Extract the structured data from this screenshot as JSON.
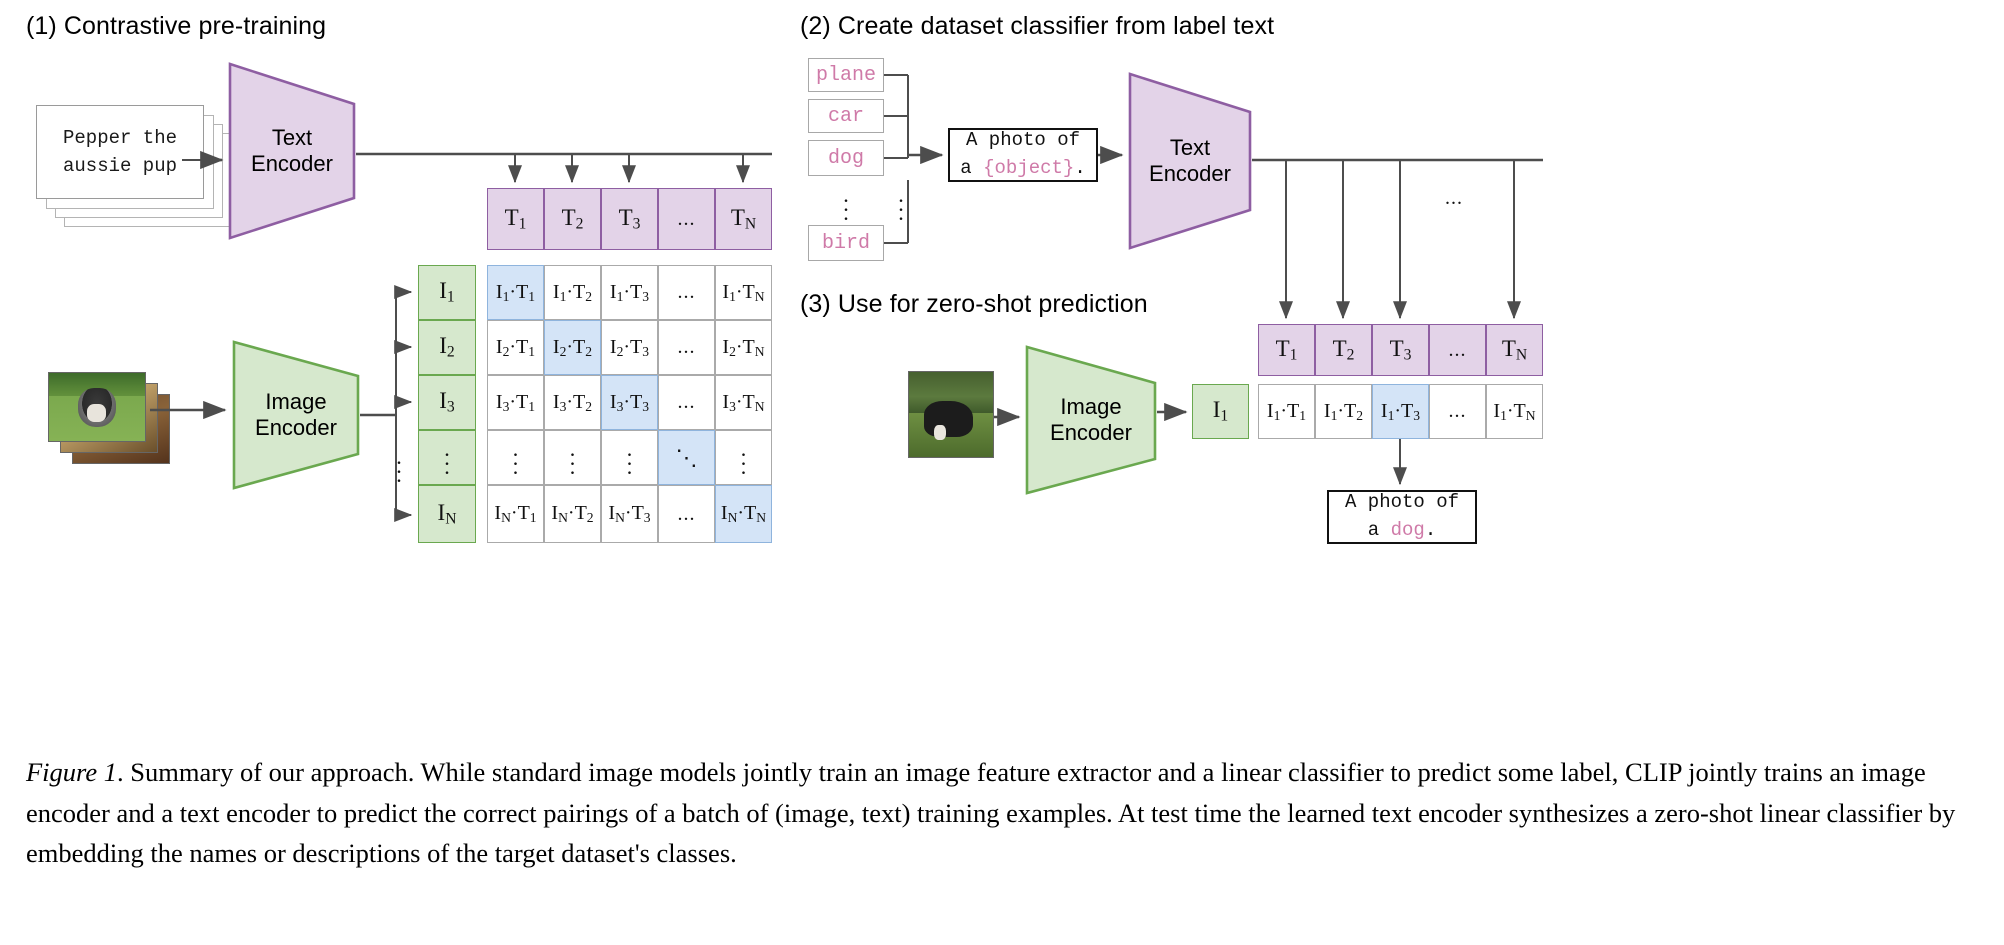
{
  "figure": {
    "caption_label": "Figure 1",
    "caption_text": ". Summary of our approach. While standard image models jointly train an image feature extractor and a linear classifier to predict some label, CLIP jointly trains an image encoder and a text encoder to predict the correct pairings of a batch of (image, text) training examples. At test time the learned text encoder synthesizes a zero-shot linear classifier by embedding the names or descriptions of the target dataset's classes."
  },
  "colors": {
    "text_encoder_fill": "#e3d3e8",
    "text_encoder_stroke": "#8e5ea2",
    "image_encoder_fill": "#d6e8cd",
    "image_encoder_stroke": "#6aa84f",
    "highlight_cell_fill": "#d4e4f7",
    "highlight_cell_stroke": "#8fb4dd",
    "label_pink": "#cf7aa8",
    "grid_stroke": "#aaaaaa",
    "arrow_stroke": "#4d4d4d"
  },
  "panel1": {
    "title": "(1) Contrastive pre-training",
    "input_caption": "Pepper the\naussie pup",
    "text_encoder_label": "Text\nEncoder",
    "image_encoder_label": "Image\nEncoder",
    "text_tokens": [
      "T₁",
      "T₂",
      "T₃",
      "...",
      "Tₙ"
    ],
    "text_tokens_parts": [
      {
        "base": "T",
        "sub": "1"
      },
      {
        "base": "T",
        "sub": "2"
      },
      {
        "base": "T",
        "sub": "3"
      },
      {
        "base": "...",
        "sub": ""
      },
      {
        "base": "T",
        "sub": "N"
      }
    ],
    "image_tokens_parts": [
      {
        "base": "I",
        "sub": "1"
      },
      {
        "base": "I",
        "sub": "2"
      },
      {
        "base": "I",
        "sub": "3"
      },
      {
        "base": "⋮",
        "sub": ""
      },
      {
        "base": "I",
        "sub": "N"
      }
    ],
    "matrix": {
      "row_labels": [
        "1",
        "2",
        "3",
        "⋮",
        "N"
      ],
      "col_labels": [
        "1",
        "2",
        "3",
        "...",
        "N"
      ],
      "cells": [
        [
          "I₁·T₁",
          "I₁·T₂",
          "I₁·T₃",
          "...",
          "I₁·Tₙ"
        ],
        [
          "I₂·T₁",
          "I₂·T₂",
          "I₂·T₃",
          "...",
          "I₂·Tₙ"
        ],
        [
          "I₃·T₁",
          "I₃·T₂",
          "I₃·T₃",
          "...",
          "I₃·Tₙ"
        ],
        [
          "⋮",
          "⋮",
          "⋮",
          "⋱",
          "⋮"
        ],
        [
          "Iₙ·T₁",
          "Iₙ·T₂",
          "Iₙ·T₃",
          "...",
          "Iₙ·Tₙ"
        ]
      ],
      "highlighted_diagonal": [
        [
          0,
          0
        ],
        [
          1,
          1
        ],
        [
          2,
          2
        ],
        [
          3,
          3
        ],
        [
          4,
          4
        ]
      ]
    }
  },
  "panel2": {
    "title": "(2) Create dataset classifier from label text",
    "labels": [
      "plane",
      "car",
      "dog",
      "bird"
    ],
    "label_ellipsis": "⋮",
    "prompt_prefix": "A photo of\na ",
    "prompt_slot": "{object}",
    "prompt_suffix": ".",
    "text_encoder_label": "Text\nEncoder",
    "text_tokens_parts": [
      {
        "base": "T",
        "sub": "1"
      },
      {
        "base": "T",
        "sub": "2"
      },
      {
        "base": "T",
        "sub": "3"
      },
      {
        "base": "...",
        "sub": ""
      },
      {
        "base": "T",
        "sub": "N"
      }
    ],
    "horizontal_ellipsis": "..."
  },
  "panel3": {
    "title": "(3) Use for zero-shot prediction",
    "image_encoder_label": "Image\nEncoder",
    "image_token": {
      "base": "I",
      "sub": "1"
    },
    "similarity_cells": [
      "I₁·T₁",
      "I₁·T₂",
      "I₁·T₃",
      "...",
      "I₁·Tₙ"
    ],
    "highlighted_index": 2,
    "prediction_prefix": "A photo of\na ",
    "prediction_class": "dog",
    "prediction_suffix": "."
  }
}
